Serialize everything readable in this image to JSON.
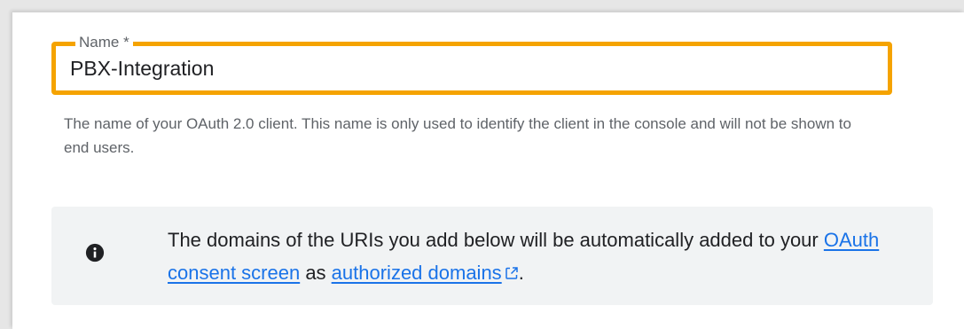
{
  "form": {
    "name_field": {
      "label": "Name *",
      "value": "PBX-Integration",
      "highlight_color": "#f5a300"
    },
    "helper_text": "The name of your OAuth 2.0 client. This name is only used to identify the client in the console and will not be shown to end users."
  },
  "info_banner": {
    "icon": "info-icon",
    "text_before": "The domains of the URIs you add below will be automatically added to your ",
    "link_consent": "OAuth consent screen",
    "text_middle": " as ",
    "link_domains": "authorized domains",
    "link_domains_icon": "external-link-icon",
    "text_after": "."
  }
}
